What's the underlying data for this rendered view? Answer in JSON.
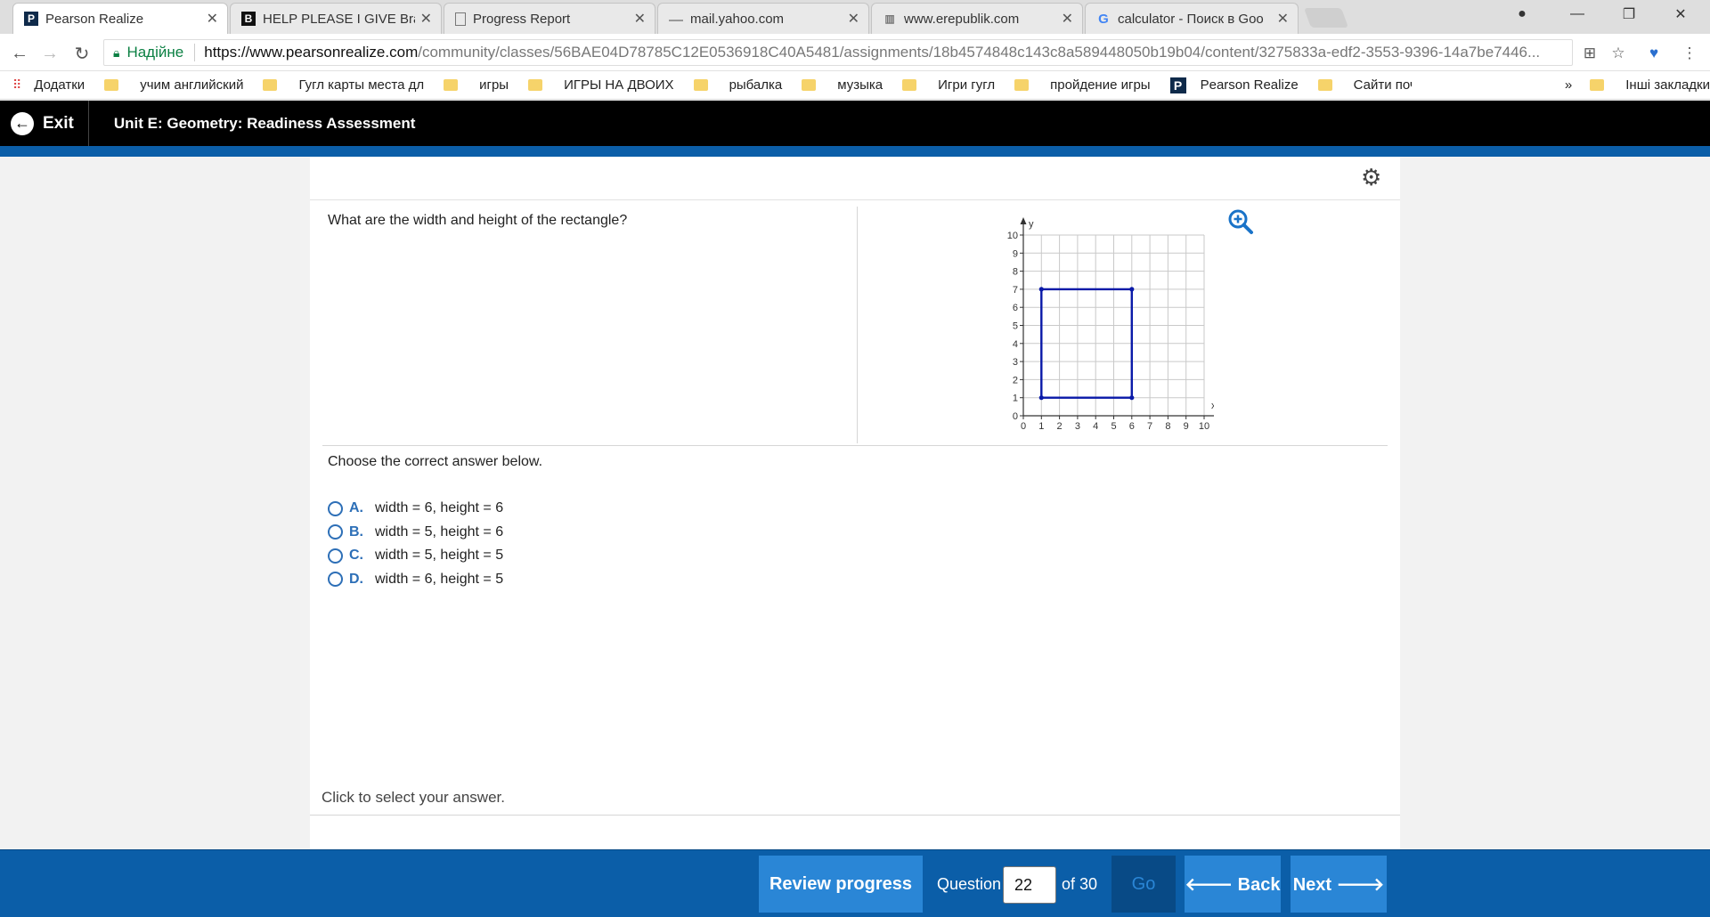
{
  "browser": {
    "tabs": [
      {
        "title": "Pearson Realize",
        "favicon": "P"
      },
      {
        "title": "HELP PLEASE I GIVE Brain",
        "favicon": "B"
      },
      {
        "title": "Progress Report",
        "favicon": "doc"
      },
      {
        "title": "mail.yahoo.com",
        "favicon": "mail"
      },
      {
        "title": "www.erepublik.com",
        "favicon": "erep"
      },
      {
        "title": "calculator - Поиск в Goo",
        "favicon": "G"
      }
    ],
    "secure_label": "Надійне",
    "url_host": "https://www.pearsonrealize.com",
    "url_path": "/community/classes/56BAE04D78785C12E0536918C40A5481/assignments/18b4574848c143c8a589448050b19b04/content/3275833a-edf2-3553-9396-14a7be7446...",
    "bookmarks": [
      {
        "label": "Додатки",
        "icon": "apps-icon"
      },
      {
        "label": "учим английский",
        "icon": "folder"
      },
      {
        "label": "Гугл карты места дл",
        "icon": "folder"
      },
      {
        "label": "игры",
        "icon": "folder"
      },
      {
        "label": "ИГРЫ НА ДВОИХ",
        "icon": "folder"
      },
      {
        "label": "рыбалка",
        "icon": "folder"
      },
      {
        "label": "музыка",
        "icon": "folder"
      },
      {
        "label": "Игри гугл",
        "icon": "folder"
      },
      {
        "label": "пройдение игры",
        "icon": "folder"
      },
      {
        "label": "Pearson Realize",
        "icon": "pearson"
      },
      {
        "label": "Сайти почта так дал",
        "icon": "folder"
      }
    ],
    "more_bookmarks": "»",
    "other_bookmarks": "Інші закладки"
  },
  "app": {
    "exit_label": "Exit",
    "unit_title": "Unit E: Geometry: Readiness Assessment"
  },
  "question": {
    "prompt": "What are the width and height of the rectangle?",
    "choose_label": "Choose the correct answer below.",
    "options": [
      {
        "letter": "A.",
        "text": "width = 6, height = 6"
      },
      {
        "letter": "B.",
        "text": "width = 5, height = 6"
      },
      {
        "letter": "C.",
        "text": "width = 5, height = 5"
      },
      {
        "letter": "D.",
        "text": "width = 6, height = 5"
      }
    ],
    "hint": "Click to select your answer."
  },
  "graph": {
    "x_label": "x",
    "y_label": "y",
    "x_ticks": [
      "0",
      "1",
      "2",
      "3",
      "4",
      "5",
      "6",
      "7",
      "8",
      "9",
      "10"
    ],
    "y_ticks": [
      "0",
      "1",
      "2",
      "3",
      "4",
      "5",
      "6",
      "7",
      "8",
      "9",
      "10"
    ],
    "range": [
      0,
      10
    ],
    "rectangle": {
      "x1": 1,
      "y1": 1,
      "x2": 6,
      "y2": 7
    },
    "rect_color": "#0a1aa8"
  },
  "footer": {
    "review_label": "Review progress",
    "question_label": "Question",
    "current_question": "22",
    "of_label": "of 30",
    "go_label": "Go",
    "back_label": "🡐 Back",
    "next_label": "Next 🡒"
  },
  "colors": {
    "brand_blue": "#0b5ea8",
    "button_blue": "#2a86d6",
    "option_blue": "#2d6fb7"
  }
}
